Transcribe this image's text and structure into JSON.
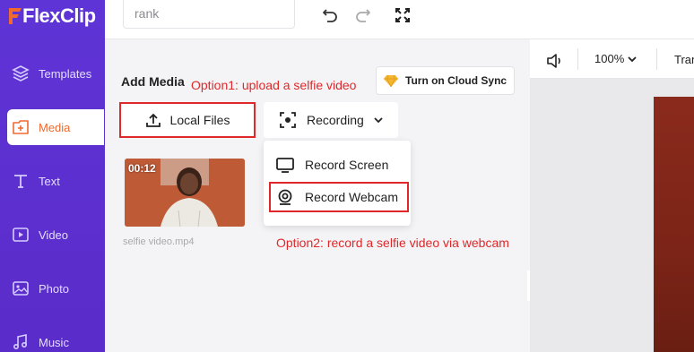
{
  "app": {
    "logo_text": "FlexClip"
  },
  "sidebar": {
    "items": [
      {
        "label": "Templates",
        "icon": "templates-icon"
      },
      {
        "label": "Media",
        "icon": "media-icon",
        "active": true
      },
      {
        "label": "Text",
        "icon": "text-icon"
      },
      {
        "label": "Video",
        "icon": "video-icon"
      },
      {
        "label": "Photo",
        "icon": "photo-icon"
      },
      {
        "label": "Music",
        "icon": "music-icon"
      }
    ]
  },
  "topbar": {
    "search_value": "rank",
    "undo_icon": "undo-icon",
    "redo_icon": "redo-icon",
    "fullscreen_icon": "fullscreen-icon"
  },
  "panel": {
    "title": "Add Media",
    "annotation1": "Option1: upload a selfie video",
    "annotation2": "Option2: record a selfie video via webcam",
    "cloud_sync_label": "Turn on Cloud Sync",
    "local_files_label": "Local Files",
    "recording_label": "Recording",
    "media": [
      {
        "duration": "00:12",
        "filename": "selfie video.mp4"
      }
    ],
    "recording_menu": [
      {
        "label": "Record Screen",
        "icon": "monitor-icon"
      },
      {
        "label": "Record Webcam",
        "icon": "webcam-icon",
        "highlighted": true
      }
    ]
  },
  "preview": {
    "volume_icon": "volume-icon",
    "zoom": "100%",
    "transition_label": "Tran"
  },
  "colors": {
    "sidebar": "#5b2fd0",
    "accent": "#ef6a2e",
    "annotation": "#e0282a"
  }
}
